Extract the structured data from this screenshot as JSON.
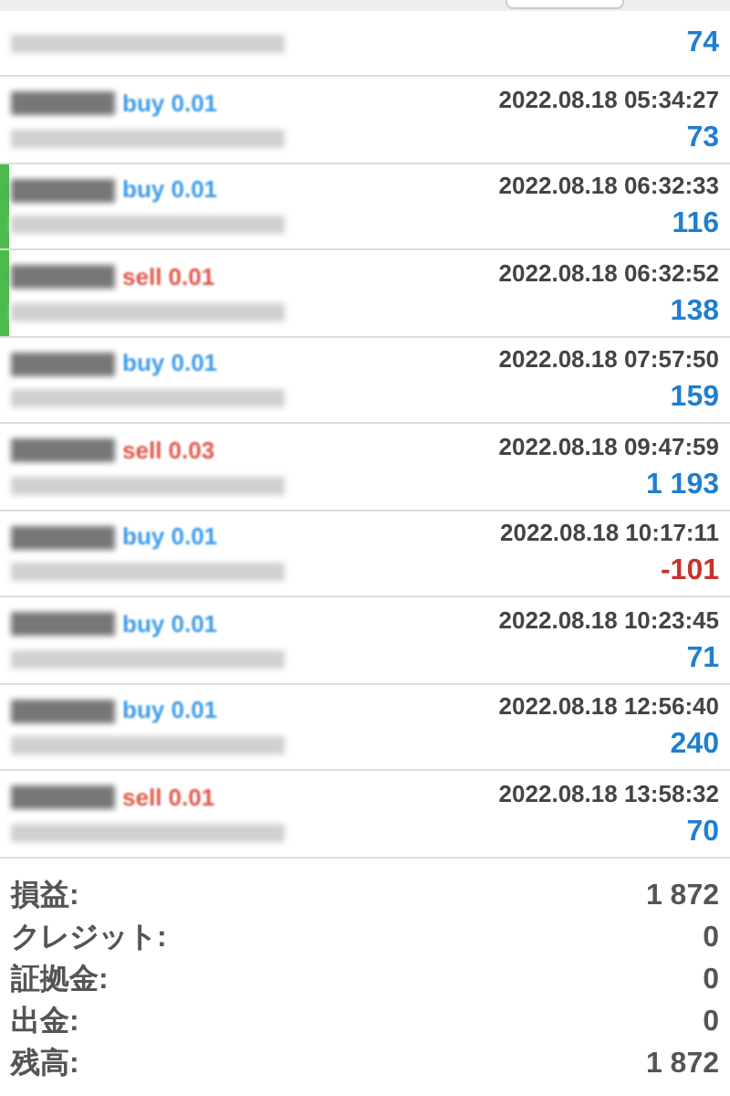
{
  "deals": [
    {
      "marked": false,
      "profit": "74",
      "loss": false
    },
    {
      "side": "buy",
      "volume": "0.01",
      "marked": false,
      "time": "2022.08.18 05:34:27",
      "profit": "73",
      "loss": false
    },
    {
      "side": "buy",
      "volume": "0.01",
      "marked": true,
      "time": "2022.08.18 06:32:33",
      "profit": "116",
      "loss": false
    },
    {
      "side": "sell",
      "volume": "0.01",
      "marked": true,
      "time": "2022.08.18 06:32:52",
      "profit": "138",
      "loss": false
    },
    {
      "side": "buy",
      "volume": "0.01",
      "marked": false,
      "time": "2022.08.18 07:57:50",
      "profit": "159",
      "loss": false
    },
    {
      "side": "sell",
      "volume": "0.03",
      "marked": false,
      "time": "2022.08.18 09:47:59",
      "profit": "1 193",
      "loss": false
    },
    {
      "side": "buy",
      "volume": "0.01",
      "marked": false,
      "time": "2022.08.18 10:17:11",
      "profit": "-101",
      "loss": true
    },
    {
      "side": "buy",
      "volume": "0.01",
      "marked": false,
      "time": "2022.08.18 10:23:45",
      "profit": "71",
      "loss": false
    },
    {
      "side": "buy",
      "volume": "0.01",
      "marked": false,
      "time": "2022.08.18 12:56:40",
      "profit": "240",
      "loss": false
    },
    {
      "side": "sell",
      "volume": "0.01",
      "marked": false,
      "time": "2022.08.18 13:58:32",
      "profit": "70",
      "loss": false
    }
  ],
  "summary": [
    {
      "label": "損益:",
      "value": "1 872"
    },
    {
      "label": "クレジット:",
      "value": "0"
    },
    {
      "label": "証拠金:",
      "value": "0"
    },
    {
      "label": "出金:",
      "value": "0"
    },
    {
      "label": "残高:",
      "value": "1 872"
    }
  ]
}
